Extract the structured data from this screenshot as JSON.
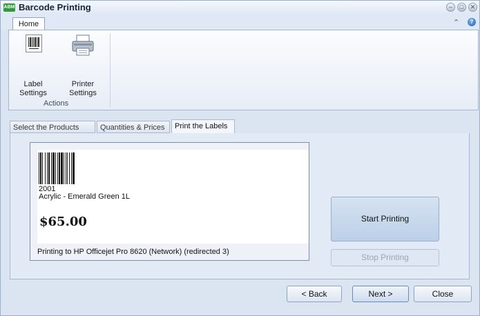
{
  "window": {
    "title": "Barcode Printing",
    "app_icon_text": "ABM"
  },
  "ribbon": {
    "home_tab": "Home",
    "buttons": [
      {
        "label_line1": "Label",
        "label_line2": "Settings",
        "icon": "barcode-label-icon"
      },
      {
        "label_line1": "Printer",
        "label_line2": "Settings",
        "icon": "printer-icon"
      }
    ],
    "group_label": "Actions"
  },
  "wizard_tabs": [
    "Select the Products",
    "Quantities & Prices",
    "Print the Labels"
  ],
  "active_tab": "Print the Labels",
  "preview": {
    "barcode_number": "2001",
    "product_description": "Acrylic - Emerald Green 1L",
    "price": "$65.00",
    "printing_to": "Printing to HP Officejet Pro 8620 (Network) (redirected 3)"
  },
  "actions": {
    "start": "Start Printing",
    "stop": "Stop Printing"
  },
  "footer": {
    "back": "< Back",
    "next": "Next >",
    "close": "Close"
  }
}
